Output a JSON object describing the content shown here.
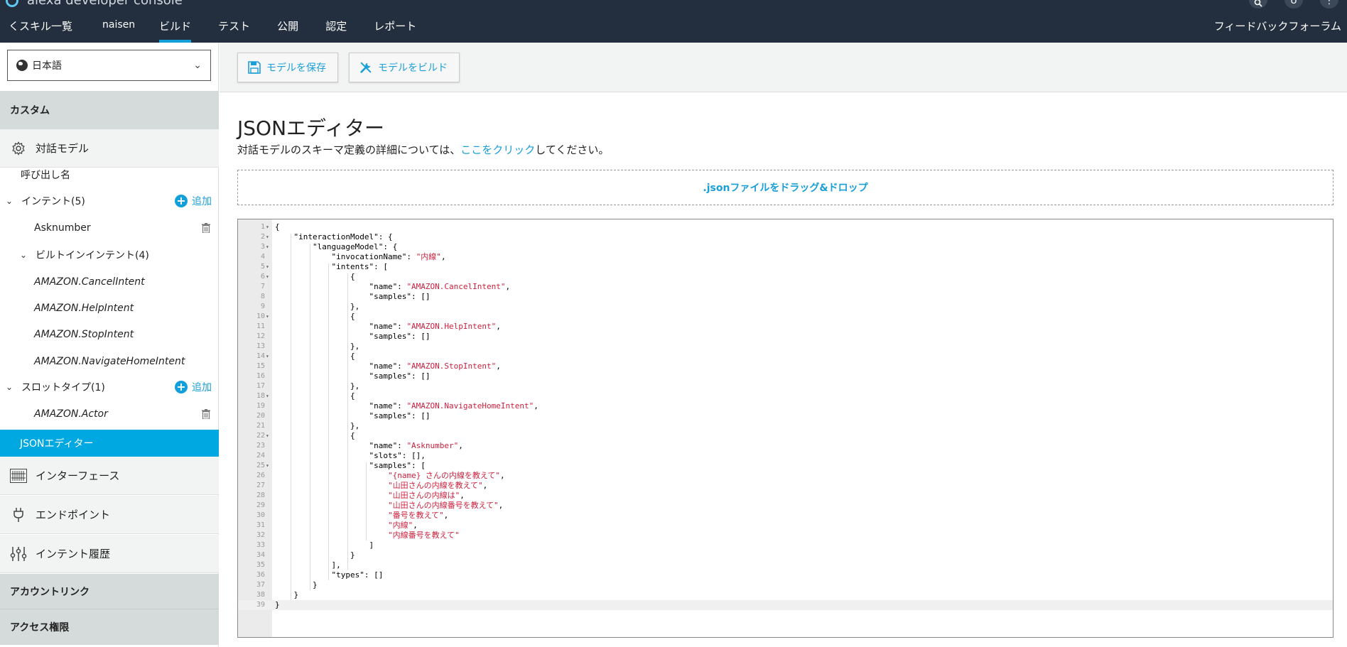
{
  "header": {
    "app_title": "alexa developer console",
    "back_label": "くスキル一覧",
    "skill_name": "naisen",
    "tabs": [
      "ビルド",
      "テスト",
      "公開",
      "認定",
      "レポート"
    ],
    "user_initial": "U",
    "feedback_label": "フィードバックフォーラム"
  },
  "sidebar": {
    "locale": "日本語",
    "custom_heading": "カスタム",
    "dialog_model": "対話モデル",
    "invocation_name": "呼び出し名",
    "intents_label": "インテント(5)",
    "add_label": "追加",
    "intent_asknumber": "Asknumber",
    "builtin_intents_label": "ビルトインインテント(4)",
    "builtin_intents": [
      "AMAZON.CancelIntent",
      "AMAZON.HelpIntent",
      "AMAZON.StopIntent",
      "AMAZON.NavigateHomeIntent"
    ],
    "slot_types_label": "スロットタイプ(1)",
    "slot_type_actor": "AMAZON.Actor",
    "json_editor": "JSONエディター",
    "interfaces": "インターフェース",
    "endpoint": "エンドポイント",
    "intent_history": "インテント履歴",
    "account_linking": "アカウントリンク",
    "permissions": "アクセス権限"
  },
  "toolbar": {
    "save_model": "モデルを保存",
    "build_model": "モデルをビルド"
  },
  "main": {
    "title": "JSONエディター",
    "subtitle_pre": "対話モデルのスキーマ定義の詳細については、",
    "subtitle_link": "ここをクリック",
    "subtitle_post": "してください。",
    "dropzone_label": ".jsonファイルをドラッグ&ドロップ"
  },
  "editor": {
    "lines": [
      "{",
      "    \"interactionModel\": {",
      "        \"languageModel\": {",
      "            \"invocationName\": \"内線\",",
      "            \"intents\": [",
      "                {",
      "                    \"name\": \"AMAZON.CancelIntent\",",
      "                    \"samples\": []",
      "                },",
      "                {",
      "                    \"name\": \"AMAZON.HelpIntent\",",
      "                    \"samples\": []",
      "                },",
      "                {",
      "                    \"name\": \"AMAZON.StopIntent\",",
      "                    \"samples\": []",
      "                },",
      "                {",
      "                    \"name\": \"AMAZON.NavigateHomeIntent\",",
      "                    \"samples\": []",
      "                },",
      "                {",
      "                    \"name\": \"Asknumber\",",
      "                    \"slots\": [],",
      "                    \"samples\": [",
      "                        \"{name} さんの内線を教えて\",",
      "                        \"山田さんの内線を教えて\",",
      "                        \"山田さんの内線は\",",
      "                        \"山田さんの内線番号を教えて\",",
      "                        \"番号を教えて\",",
      "                        \"内線\",",
      "                        \"内線番号を教えて\"",
      "                    ]",
      "                }",
      "            ],",
      "            \"types\": []",
      "        }",
      "    }",
      "}"
    ],
    "foldable": [
      1,
      2,
      3,
      5,
      6,
      10,
      14,
      18,
      22,
      25
    ]
  }
}
